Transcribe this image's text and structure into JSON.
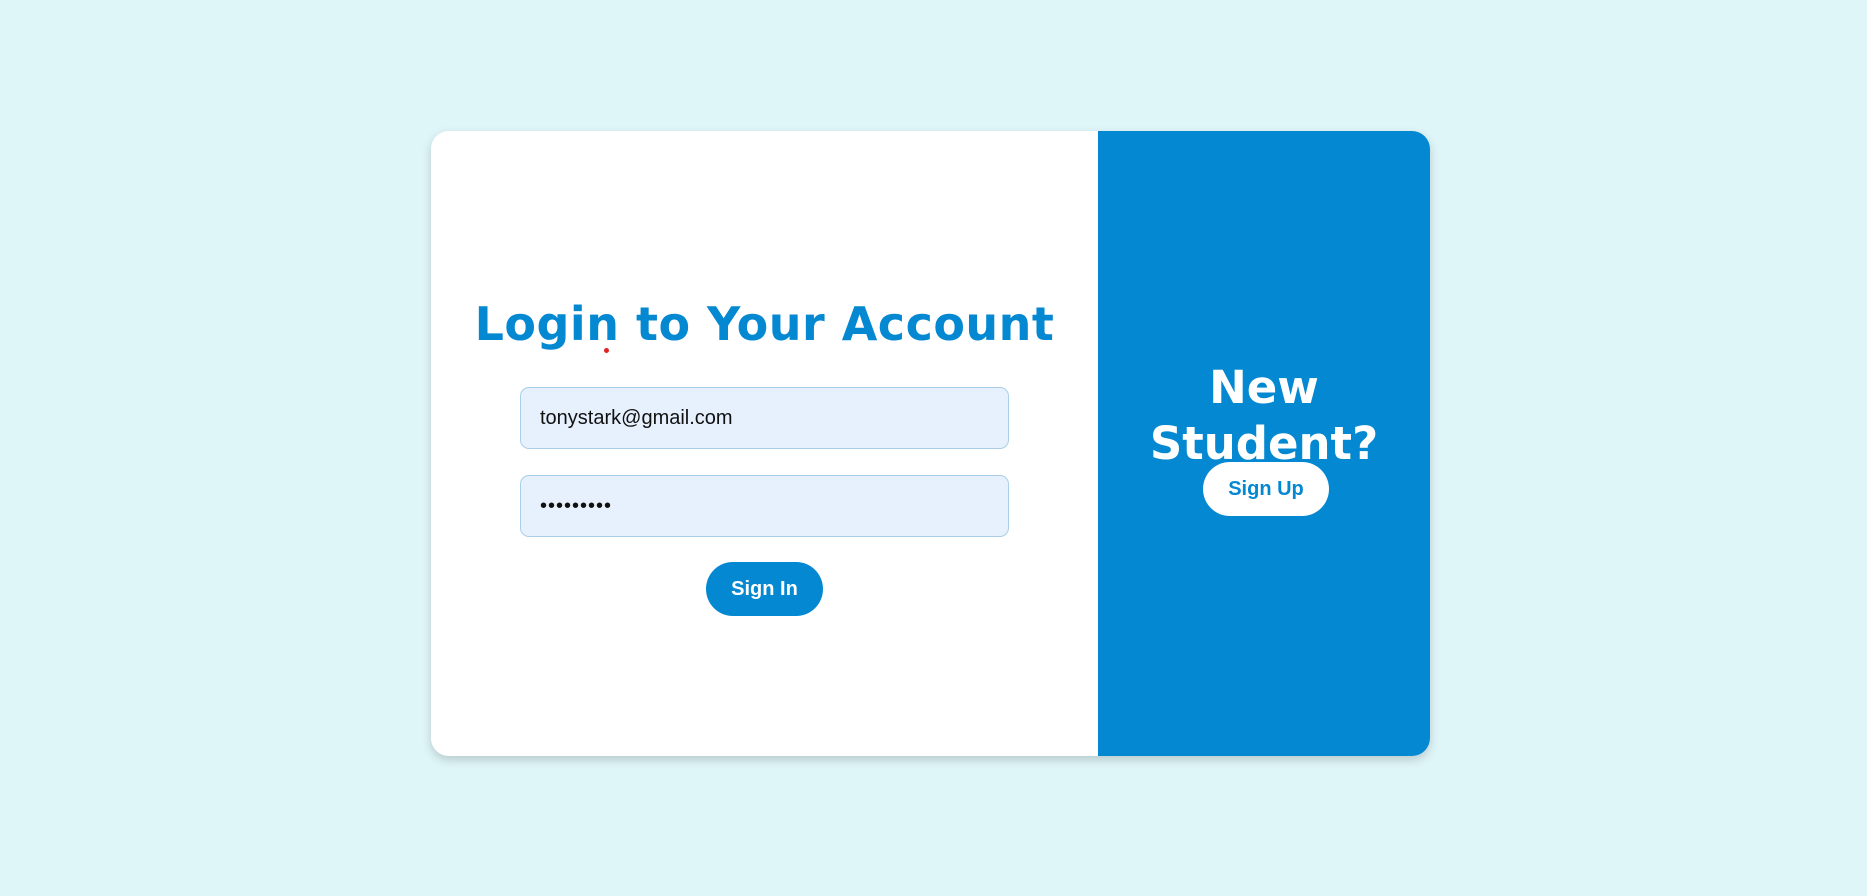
{
  "login": {
    "title": "Login to Your Account",
    "email_value": "tonystark@gmail.com",
    "password_value": "password1",
    "sign_in_label": "Sign In"
  },
  "signup": {
    "title": "New Student?",
    "sign_up_label": "Sign Up"
  },
  "colors": {
    "page_background": "#dff6f9",
    "accent": "#0388d1",
    "input_background": "#e7f0fd"
  }
}
